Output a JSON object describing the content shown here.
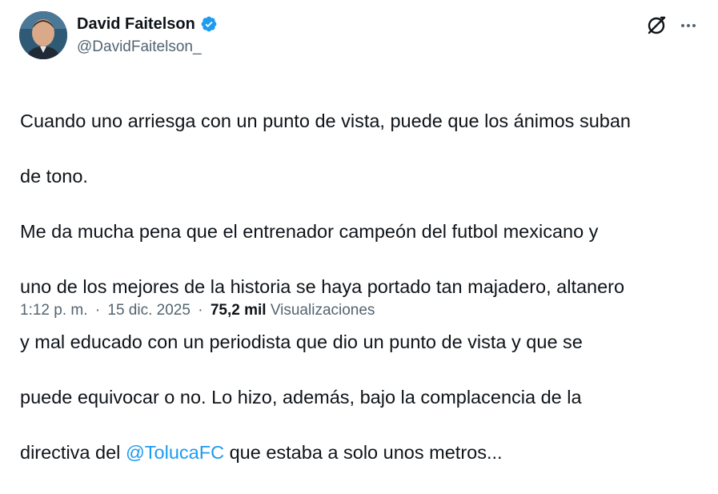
{
  "author": {
    "display_name": "David Faitelson",
    "handle": "@DavidFaitelson_",
    "verified": true
  },
  "tweet": {
    "lines": [
      "Cuando uno arriesga con un punto de vista, puede que los ánimos suban",
      "de tono.",
      "Me da mucha pena que el entrenador campeón del futbol mexicano y",
      "uno de los mejores de la historia se haya portado tan majadero, altanero",
      "y mal educado con un periodista que dio un punto de vista y que se",
      "puede equivocar o no. Lo hizo, además, bajo la complacencia  de la"
    ],
    "last_line_prefix": "directiva del ",
    "mention": "@TolucaFC",
    "last_line_suffix": " que estaba a solo unos metros..."
  },
  "meta": {
    "time": "1:12 p. m.",
    "separator": "·",
    "date": "15 dic. 2025",
    "views_count": "75,2 mil",
    "views_label": "Visualizaciones"
  },
  "icons": {
    "verified": "verified-badge-icon",
    "grok": "grok-icon",
    "more": "more-options-icon"
  },
  "colors": {
    "text": "#0f1419",
    "secondary": "#536471",
    "link": "#1d9bf0",
    "verified": "#1d9bf0"
  }
}
